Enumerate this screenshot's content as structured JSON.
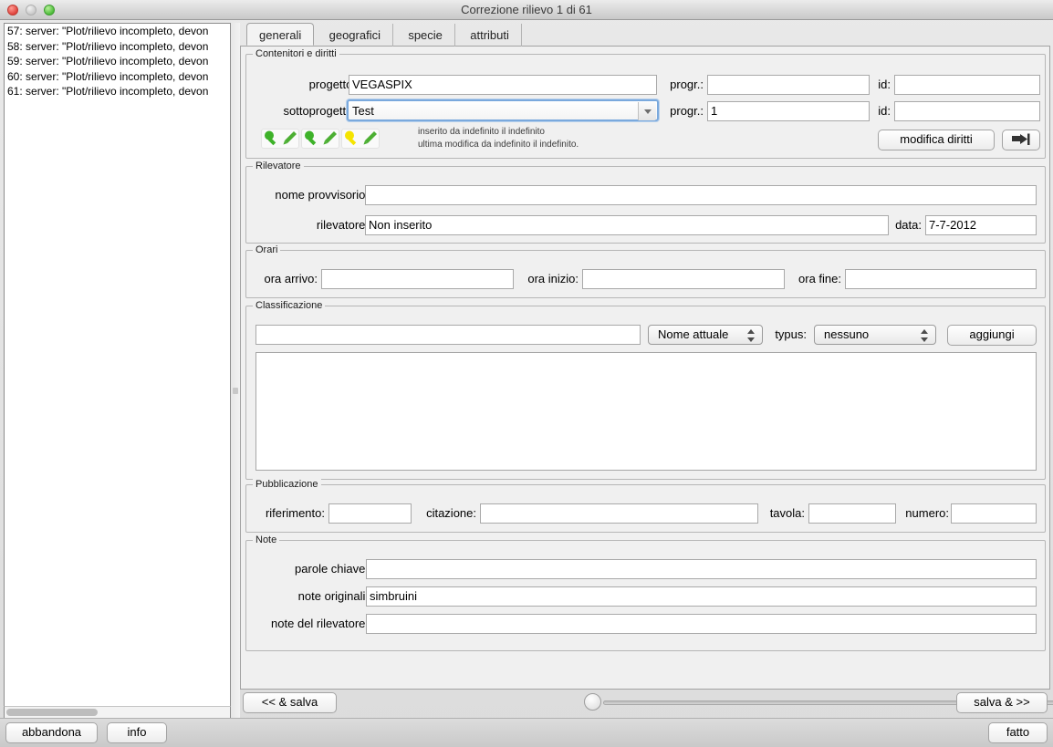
{
  "window": {
    "title": "Correzione rilievo 1 di 61",
    "traffic": {
      "close": "close-button",
      "minimize": "minimize-button",
      "zoom": "zoom-button"
    }
  },
  "log": {
    "lines": [
      "57: server: \"Plot/rilievo incompleto, devon",
      "58: server: \"Plot/rilievo incompleto, devon",
      "59: server: \"Plot/rilievo incompleto, devon",
      "60: server: \"Plot/rilievo incompleto, devon",
      "61: server: \"Plot/rilievo incompleto, devon"
    ]
  },
  "tabs": [
    {
      "label": "generali",
      "active": true
    },
    {
      "label": "geografici",
      "active": false
    },
    {
      "label": "specie",
      "active": false
    },
    {
      "label": "attributi",
      "active": false
    }
  ],
  "contenitori": {
    "legend": "Contenitori e diritti",
    "progetto_label": "progetto:",
    "progetto_value": "VEGASPIX",
    "progetto_progr_label": "progr.:",
    "progetto_progr_value": "",
    "progetto_id_label": "id:",
    "progetto_id_value": "",
    "sottoprogetto_label": "sottoprogetto:",
    "sottoprogetto_value": "Test",
    "sottoprogetto_progr_label": "progr.:",
    "sottoprogetto_progr_value": "1",
    "sottoprogetto_id_label": "id:",
    "sottoprogetto_id_value": "",
    "meta_line1": "inserito da indefinito il indefinito",
    "meta_line2": "ultima modifica da indefinito il indefinito.",
    "modifica_diritti_label": "modifica diritti",
    "perm_icons": [
      "magnifier-pencil-green",
      "magnifier-pencil-green",
      "magnifier-pencil-yellow"
    ],
    "colors": {
      "green": "#3eb22a",
      "yellow": "#f5e400",
      "pencil": "#4caf33"
    }
  },
  "rilevatore": {
    "legend": "Rilevatore",
    "nome_provvisorio_label": "nome provvisorio:",
    "nome_provvisorio_value": "",
    "rilevatore_label": "rilevatore:",
    "rilevatore_value": "Non inserito",
    "data_label": "data:",
    "data_value": "7-7-2012"
  },
  "orari": {
    "legend": "Orari",
    "ora_arrivo_label": "ora arrivo:",
    "ora_arrivo_value": "",
    "ora_inizio_label": "ora inizio:",
    "ora_inizio_value": "",
    "ora_fine_label": "ora fine:",
    "ora_fine_value": ""
  },
  "classificazione": {
    "legend": "Classificazione",
    "search_value": "",
    "nome_select_value": "Nome attuale",
    "typus_label": "typus:",
    "typus_select_value": "nessuno",
    "aggiungi_label": "aggiungi",
    "list_items": []
  },
  "pubblicazione": {
    "legend": "Pubblicazione",
    "riferimento_label": "riferimento:",
    "riferimento_value": "",
    "citazione_label": "citazione:",
    "citazione_value": "",
    "tavola_label": "tavola:",
    "tavola_value": "",
    "numero_label": "numero:",
    "numero_value": ""
  },
  "note": {
    "legend": "Note",
    "parole_chiave_label": "parole chiave:",
    "parole_chiave_value": "",
    "note_originali_label": "note originali:",
    "note_originali_value": "simbruini",
    "note_rilevatore_label": "note del rilevatore:",
    "note_rilevatore_value": ""
  },
  "nav": {
    "prev_label": "<< & salva",
    "next_label": "salva & >>",
    "slider_position": 0
  },
  "bottom": {
    "abbandona_label": "abbandona",
    "info_label": "info",
    "fatto_label": "fatto"
  }
}
